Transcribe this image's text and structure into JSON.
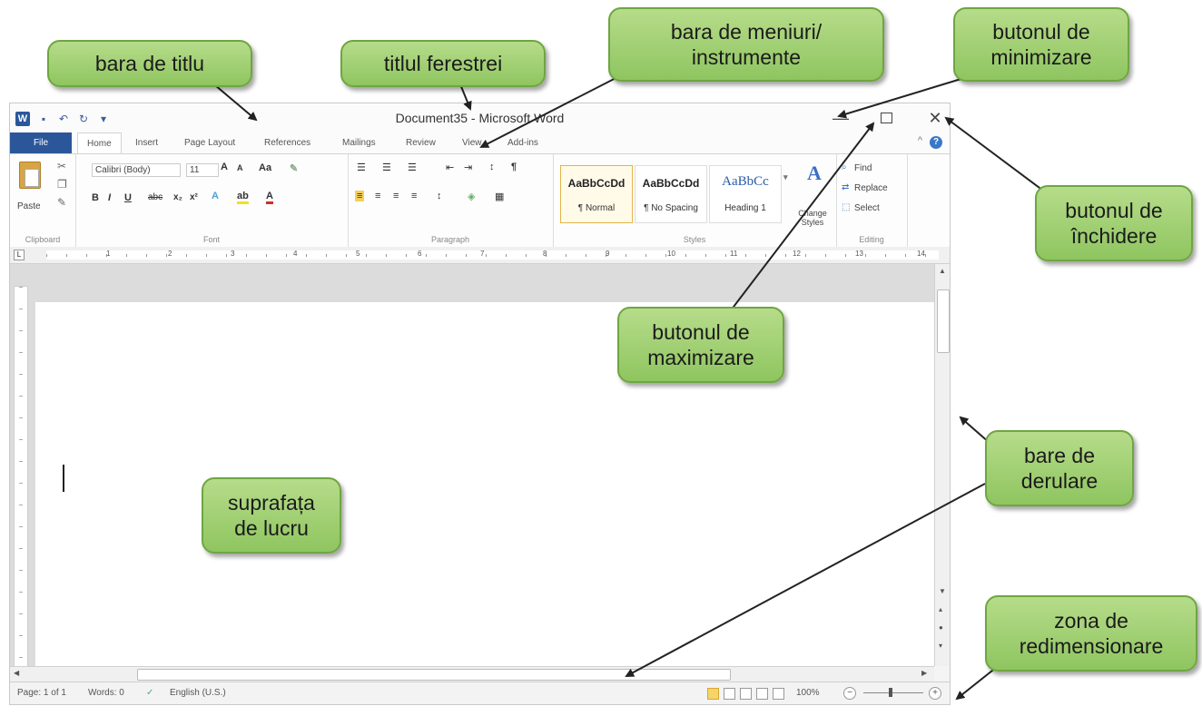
{
  "window": {
    "title": "Document35 - Microsoft Word",
    "app_icon": "W",
    "minimize_glyph": "—",
    "close_glyph": "✕",
    "help_glyph": "?",
    "collapse_glyph": "^"
  },
  "tabs": [
    {
      "label": "File"
    },
    {
      "label": "Home"
    },
    {
      "label": "Insert"
    },
    {
      "label": "Page Layout"
    },
    {
      "label": "References"
    },
    {
      "label": "Mailings"
    },
    {
      "label": "Review"
    },
    {
      "label": "View"
    },
    {
      "label": "Add-ins"
    }
  ],
  "ribbon": {
    "clipboard": {
      "label": "Clipboard",
      "paste": "Paste"
    },
    "font": {
      "label": "Font",
      "name": "Calibri (Body)",
      "size": "11"
    },
    "paragraph": {
      "label": "Paragraph"
    },
    "styles": {
      "label": "Styles",
      "items": [
        {
          "sample": "AaBbCcDd",
          "name": "¶ Normal"
        },
        {
          "sample": "AaBbCcDd",
          "name": "¶ No Spacing"
        },
        {
          "sample": "AaBbCc",
          "name": "Heading 1"
        }
      ],
      "change_styles": "Change Styles"
    },
    "editing": {
      "label": "Editing",
      "find": "Find",
      "replace": "Replace",
      "select": "Select"
    }
  },
  "ruler": {
    "numbers": [
      "1",
      "2",
      "3",
      "4",
      "5",
      "6",
      "7",
      "8",
      "9",
      "10",
      "11",
      "12",
      "13",
      "14"
    ]
  },
  "status": {
    "page": "Page: 1 of 1",
    "words": "Words: 0",
    "language": "English (U.S.)",
    "zoom": "100%",
    "zoom_out": "−",
    "zoom_in": "+"
  },
  "callouts": {
    "title_bar": "bara de titlu",
    "window_title": "titlul ferestrei",
    "menu_bar_1": "bara de meniuri/",
    "menu_bar_2": "instrumente",
    "minimize_1": "butonul de",
    "minimize_2": "minimizare",
    "close_1": "butonul de",
    "close_2": "închidere",
    "maximize_1": "butonul de",
    "maximize_2": "maximizare",
    "scrollbars_1": "bare de",
    "scrollbars_2": "derulare",
    "work_area_1": "suprafața",
    "work_area_2": "de lucru",
    "resize_1": "zona de",
    "resize_2": "redimensionare"
  },
  "colors": {
    "callout_fill": "#9fd06e",
    "callout_border": "#6ea641",
    "file_tab": "#2b579a"
  }
}
